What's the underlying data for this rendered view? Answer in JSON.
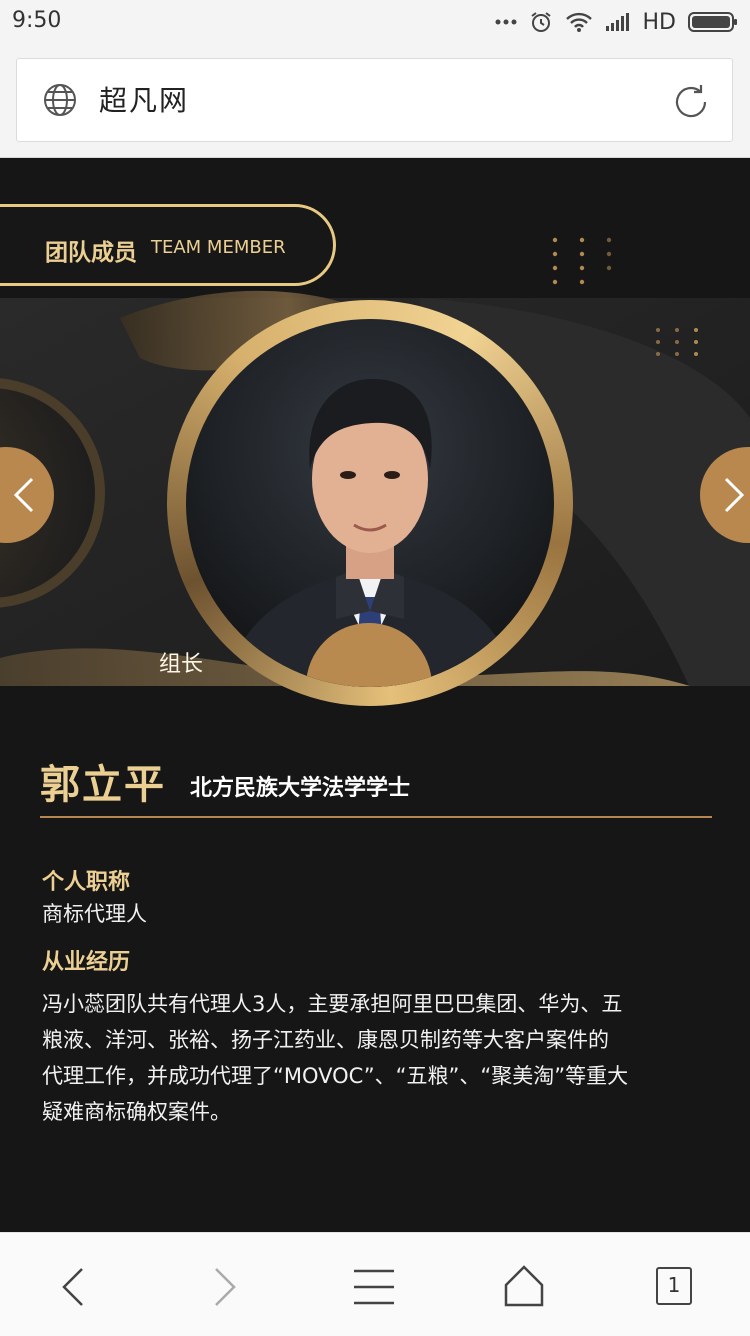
{
  "status_bar": {
    "time": "9:50",
    "network": "HD"
  },
  "url_bar": {
    "title": "超凡网"
  },
  "team_badge": {
    "cn": "团队成员",
    "en": "TEAM MEMBER"
  },
  "member": {
    "role": "组长",
    "name": "郭立平",
    "degree": "北方民族大学法学学士",
    "title_label": "个人职称",
    "title_value": "商标代理人",
    "experience_label": "从业经历",
    "experience_lines": [
      "冯小蕊团队共有代理人3人，主要承担阿里巴巴集团、华为、五",
      "粮液、洋河、张裕、扬子江药业、康恩贝制药等大客户案件的",
      "代理工作，并成功代理了“MOVOC”、“五粮”、“聚美淘”等重大",
      "疑难商标确权案件。"
    ]
  },
  "bottom_nav": {
    "tab_count": "1"
  },
  "colors": {
    "gold": "#ecd093",
    "bronze": "#b8884f",
    "background": "#161616"
  }
}
